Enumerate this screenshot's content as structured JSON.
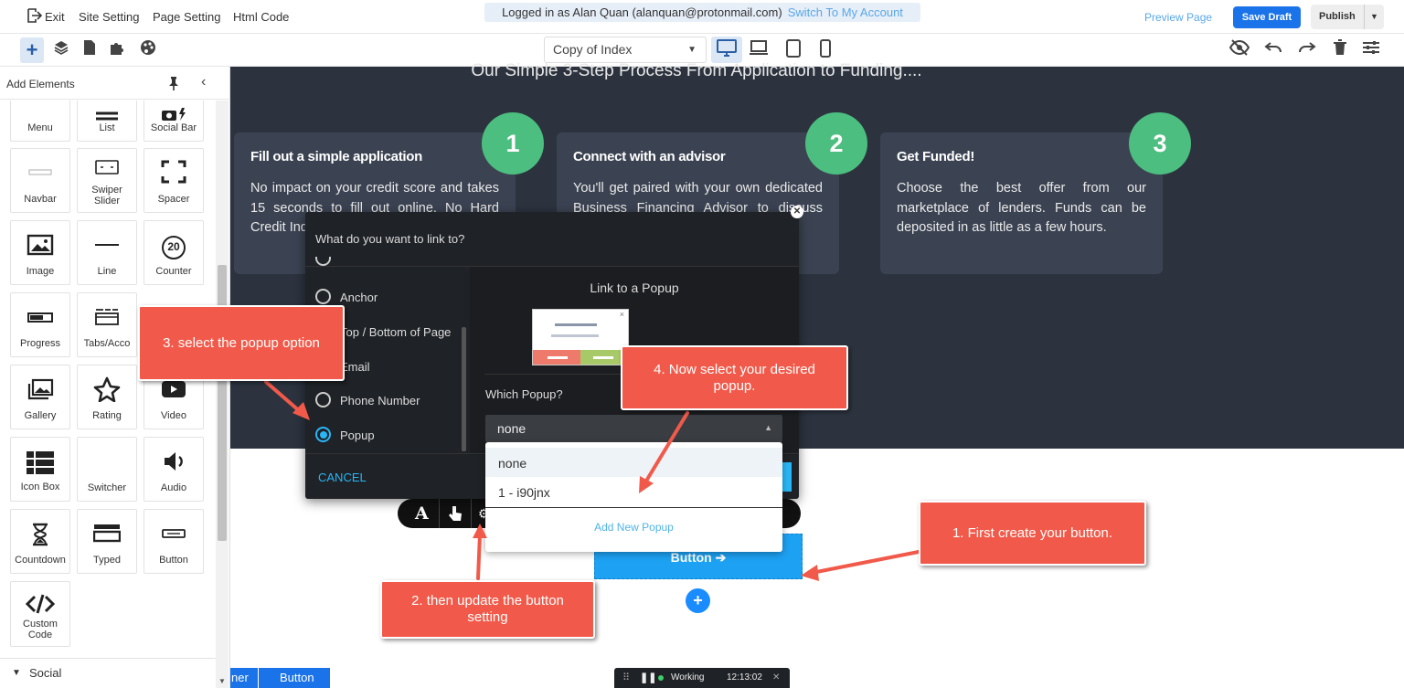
{
  "topbar": {
    "exit": "Exit",
    "site_setting": "Site Setting",
    "page_setting": "Page Setting",
    "html_code": "Html Code",
    "logged_in": "Logged in as Alan Quan (alanquan@protonmail.com)",
    "switch_account": "Switch To My Account",
    "preview": "Preview Page",
    "save_draft": "Save Draft",
    "publish": "Publish"
  },
  "toolbar": {
    "page_select": "Copy of Index"
  },
  "left_panel": {
    "title": "Add Elements",
    "tiles": [
      {
        "label": "Menu",
        "icon": "menu-icon"
      },
      {
        "label": "List",
        "icon": "list-icon"
      },
      {
        "label": "Social Bar",
        "icon": "social-bar-icon"
      },
      {
        "label": "Navbar",
        "icon": "navbar-icon"
      },
      {
        "label": "Swiper Slider",
        "icon": "slider-icon"
      },
      {
        "label": "Spacer",
        "icon": "spacer-icon"
      },
      {
        "label": "Image",
        "icon": "image-icon"
      },
      {
        "label": "Line",
        "icon": "line-icon"
      },
      {
        "label": "Counter",
        "icon": "counter-icon",
        "glyph": "20"
      },
      {
        "label": "Progress",
        "icon": "progress-icon"
      },
      {
        "label": "Tabs/Acco",
        "icon": "tabs-icon"
      },
      {
        "label": "Gallery",
        "icon": "gallery-icon"
      },
      {
        "label": "Rating",
        "icon": "star-icon"
      },
      {
        "label": "Video",
        "icon": "video-icon"
      },
      {
        "label": "Icon Box",
        "icon": "icon-box-icon"
      },
      {
        "label": "Switcher",
        "icon": "switcher-icon"
      },
      {
        "label": "Audio",
        "icon": "audio-icon"
      },
      {
        "label": "Countdown",
        "icon": "hourglass-icon"
      },
      {
        "label": "Typed",
        "icon": "typed-icon"
      },
      {
        "label": "Button",
        "icon": "button-icon"
      },
      {
        "label": "Custom Code",
        "icon": "code-icon"
      }
    ],
    "social_section": "Social"
  },
  "canvas": {
    "heading": "Our Simple 3-Step Process From Application to Funding....",
    "steps": [
      {
        "number": "1",
        "title": "Fill out a simple application",
        "text": "No impact on your credit score and takes 15 seconds to fill out online. No Hard Credit Inquiries"
      },
      {
        "number": "2",
        "title": "Connect with an advisor",
        "text": "You'll get paired with your own dedicated Business Financing Advisor to discuss your options at no cost"
      },
      {
        "number": "3",
        "title": "Get Funded!",
        "text": "Choose the best offer from our marketplace of lenders. Funds can be deposited in as little as a few hours."
      }
    ],
    "button_label": "Button"
  },
  "modal": {
    "title": "What do you want to link to?",
    "options": [
      {
        "label": "Anchor",
        "selected": false
      },
      {
        "label": "Top / Bottom of Page",
        "selected": false
      },
      {
        "label": "Email",
        "selected": false
      },
      {
        "label": "Phone Number",
        "selected": false
      },
      {
        "label": "Popup",
        "selected": true
      }
    ],
    "panel_title": "Link to a Popup",
    "which_popup": "Which Popup?",
    "selected_popup": "none",
    "cancel": "CANCEL"
  },
  "dropdown": {
    "options": [
      "none",
      "1 - i90jnx"
    ],
    "add_new": "Add New Popup"
  },
  "callouts": {
    "c1": "1. First create your button.",
    "c2": "2. then update the button setting",
    "c3": "3. select the popup option",
    "c4": "4. Now select your desired popup."
  },
  "bottombar": {
    "crumb1": "ner",
    "crumb2": "Button",
    "status": "Working",
    "time": "12:13:02"
  },
  "colors": {
    "accent": "#1a73e8",
    "step_green": "#4cbe7f",
    "callout": "#f15a4a",
    "dark_section": "#2c333f",
    "radio_on": "#29b6f6"
  }
}
